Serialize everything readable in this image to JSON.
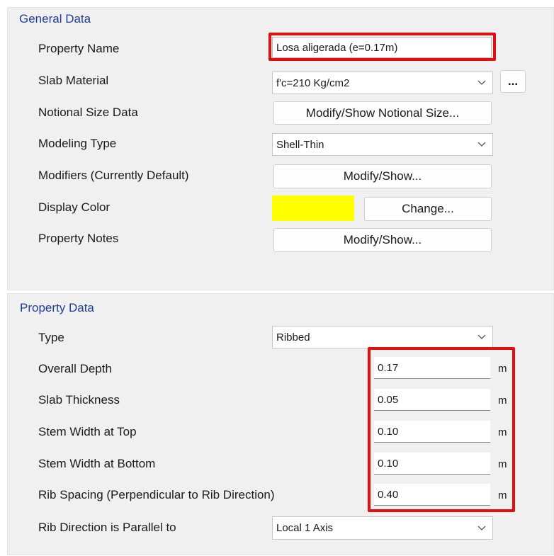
{
  "general": {
    "title": "General Data",
    "property_name": {
      "label": "Property Name",
      "value": "Losa aligerada (e=0.17m)"
    },
    "slab_material": {
      "label": "Slab Material",
      "value": "f'c=210 Kg/cm2",
      "browse_label": "..."
    },
    "notional_size": {
      "label": "Notional Size Data",
      "button": "Modify/Show Notional Size..."
    },
    "modeling_type": {
      "label": "Modeling Type",
      "value": "Shell-Thin"
    },
    "modifiers": {
      "label": "Modifiers (Currently Default)",
      "button": "Modify/Show..."
    },
    "display_color": {
      "label": "Display Color",
      "color": "#ffff00",
      "button": "Change..."
    },
    "property_notes": {
      "label": "Property Notes",
      "button": "Modify/Show..."
    }
  },
  "property_data": {
    "title": "Property Data",
    "type": {
      "label": "Type",
      "value": "Ribbed"
    },
    "overall_depth": {
      "label": "Overall Depth",
      "value": "0.17",
      "unit": "m"
    },
    "slab_thickness": {
      "label": "Slab Thickness",
      "value": "0.05",
      "unit": "m"
    },
    "stem_width_top": {
      "label": "Stem Width at Top",
      "value": "0.10",
      "unit": "m"
    },
    "stem_width_bottom": {
      "label": "Stem Width at Bottom",
      "value": "0.10",
      "unit": "m"
    },
    "rib_spacing": {
      "label": "Rib Spacing (Perpendicular to Rib Direction)",
      "value": "0.40",
      "unit": "m"
    },
    "rib_direction": {
      "label": "Rib Direction is Parallel to",
      "value": "Local 1 Axis"
    }
  },
  "colors": {
    "highlight": "#e01010",
    "group_title": "#1f3f95",
    "display_color_swatch": "#ffff00"
  },
  "icons": {
    "dropdown": "chevron-down-icon"
  }
}
